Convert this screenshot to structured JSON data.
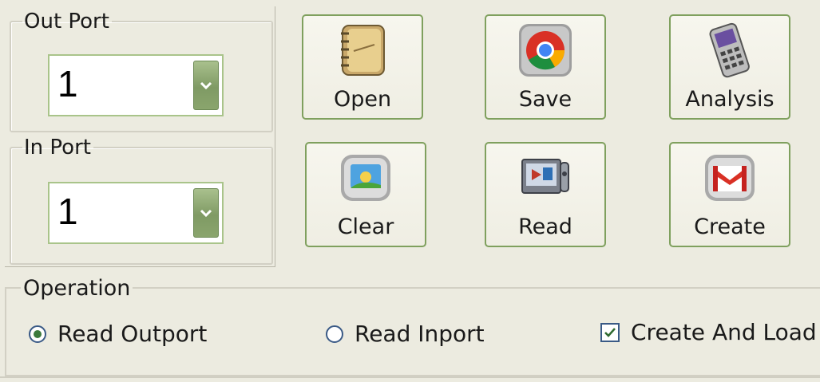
{
  "out_port": {
    "legend": "Out Port",
    "value": "1"
  },
  "in_port": {
    "legend": "In Port",
    "value": "1"
  },
  "buttons": {
    "open": "Open",
    "save": "Save",
    "analysis": "Analysis",
    "clear": "Clear",
    "read": "Read",
    "create": "Create"
  },
  "operation": {
    "title": "Operation",
    "options": [
      {
        "label": "Read Outport",
        "selected": true
      },
      {
        "label": "Read Inport",
        "selected": false
      }
    ],
    "checkbox": {
      "label": "Create And Load",
      "checked": true
    }
  },
  "icons": {
    "open": "notebook-icon",
    "save": "chrome-icon",
    "analysis": "handheld-device-icon",
    "clear": "picture-icon",
    "read": "media-player-icon",
    "create": "gmail-icon"
  },
  "colors": {
    "button_border": "#7fa05e",
    "background": "#ecebe0"
  }
}
